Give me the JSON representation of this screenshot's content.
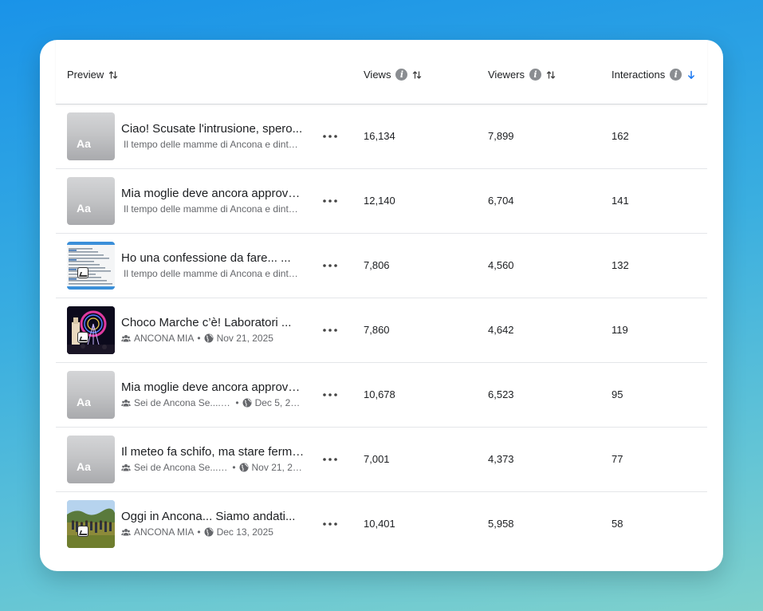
{
  "columns": {
    "preview": "Preview",
    "views": "Views",
    "viewers": "Viewers",
    "interactions": "Interactions"
  },
  "colors": {
    "sort_active": "#1877f2",
    "info_bg": "#8a8d91"
  },
  "rows": [
    {
      "title": "Ciao! Scusate l'intrusione, spero...",
      "thumb": "text",
      "subtitle": "Il tempo delle mamme di Ancona e dintorni",
      "views": "16,134",
      "viewers": "7,899",
      "interactions": "162"
    },
    {
      "title": "Mia moglie deve ancora approvare...",
      "thumb": "text",
      "subtitle": "Il tempo delle mamme di Ancona e dintorni",
      "views": "12,140",
      "viewers": "6,704",
      "interactions": "141"
    },
    {
      "title": "Ho una confessione da fare... ...",
      "thumb": "screenshot",
      "subtitle": "Il tempo delle mamme di Ancona e dintorni",
      "views": "7,806",
      "viewers": "4,560",
      "interactions": "132"
    },
    {
      "title": "Choco Marche c’è! Laboratori ...",
      "thumb": "night",
      "group": "ANCONA MIA",
      "date": "Nov 21, 2025",
      "views": "7,860",
      "viewers": "4,642",
      "interactions": "119"
    },
    {
      "title": "Mia moglie deve ancora approvare...",
      "thumb": "text",
      "group": "Sei de Ancona Se...........",
      "date": "Dec 5, 2025",
      "views": "10,678",
      "viewers": "6,523",
      "interactions": "95"
    },
    {
      "title": "Il meteo fa schifo, ma stare fermi...",
      "thumb": "text",
      "group": "Sei de Ancona Se...........",
      "date": "Nov 21, 2025",
      "views": "7,001",
      "viewers": "4,373",
      "interactions": "77"
    },
    {
      "title": "Oggi in Ancona... Siamo andati...",
      "thumb": "park",
      "group": "ANCONA MIA",
      "date": "Dec 13, 2025",
      "views": "10,401",
      "viewers": "5,958",
      "interactions": "58"
    }
  ],
  "thumb_text_label": "Aa"
}
